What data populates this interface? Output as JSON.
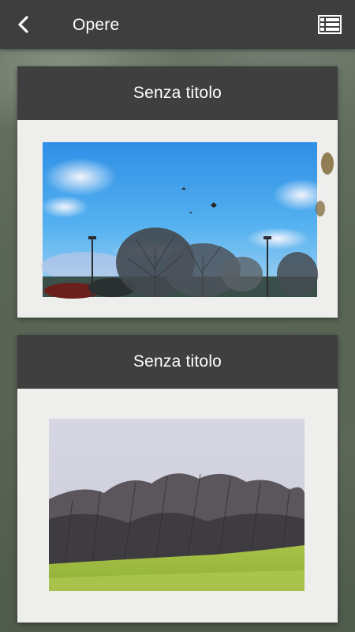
{
  "app_bar": {
    "title": "Opere",
    "back_icon": "chevron-left-icon",
    "list_icon": "list-view-icon"
  },
  "artworks": [
    {
      "title": "Senza titolo"
    },
    {
      "title": "Senza titolo"
    }
  ],
  "colors": {
    "app_bar": "#3e3e3e",
    "card_header": "#3f3f3f",
    "text": "#ffffff"
  }
}
